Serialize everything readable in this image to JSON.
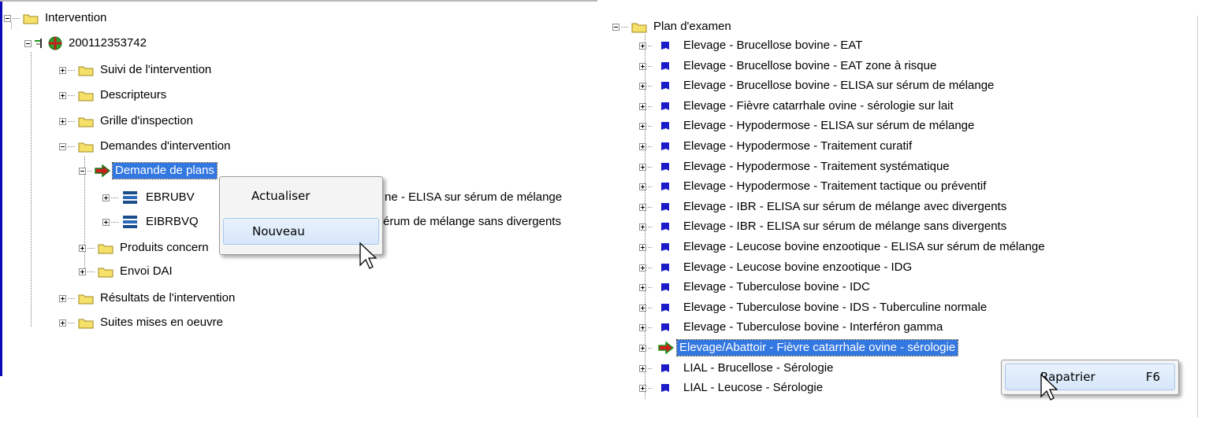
{
  "left_tree": {
    "root": "Intervention",
    "intervention_id": "200112353742",
    "items": [
      "Suivi de l'intervention",
      "Descripteurs",
      "Grille d'inspection",
      "Demandes d'intervention"
    ],
    "selected": "Demande de plans",
    "plan_rows": [
      {
        "code": "EBRUBV",
        "tail": "ne - ELISA sur sérum de mélange"
      },
      {
        "code": "EIBRBVQ",
        "tail": "érum de mélange sans divergents"
      }
    ],
    "produits": "Produits concern",
    "envoi": "Envoi DAI",
    "bottom_items": [
      "Résultats de l'intervention",
      "Suites mises en oeuvre"
    ]
  },
  "left_menu": {
    "items": [
      "Actualiser",
      "Nouveau"
    ],
    "hovered": "Nouveau"
  },
  "right_tree": {
    "root": "Plan d'examen",
    "items": [
      "Elevage - Brucellose bovine - EAT",
      "Elevage - Brucellose bovine - EAT zone à risque",
      "Elevage - Brucellose bovine - ELISA sur sérum de mélange",
      "Elevage - Fièvre catarrhale ovine - sérologie sur lait",
      "Elevage - Hypodermose - ELISA sur sérum de mélange",
      "Elevage - Hypodermose - Traitement curatif",
      "Elevage - Hypodermose - Traitement systématique",
      "Elevage - Hypodermose - Traitement tactique ou préventif",
      "Elevage - IBR - ELISA sur sérum de mélange avec divergents",
      "Elevage - IBR - ELISA sur sérum de mélange sans divergents",
      "Elevage - Leucose bovine enzootique - ELISA sur sérum de mélange",
      "Elevage - Leucose bovine enzootique - IDG",
      "Elevage - Tuberculose bovine - IDC",
      "Elevage - Tuberculose bovine - IDS - Tuberculine normale",
      "Elevage - Tuberculose bovine - Interféron gamma"
    ],
    "selected": "Elevage/Abattoir - Fièvre catarrhale ovine - sérologie",
    "after_items": [
      "LIAL - Brucellose - Sérologie",
      "LIAL - Leucose - Sérologie"
    ]
  },
  "right_menu": {
    "item": "Rapatrier",
    "shortcut": "F6"
  },
  "colors": {
    "selection": "#3377e0",
    "folder": "#f5e06a",
    "plan_marker": "#1b1bc8",
    "arrow_green": "#1a9a1a",
    "arrow_red": "#cc2020"
  }
}
